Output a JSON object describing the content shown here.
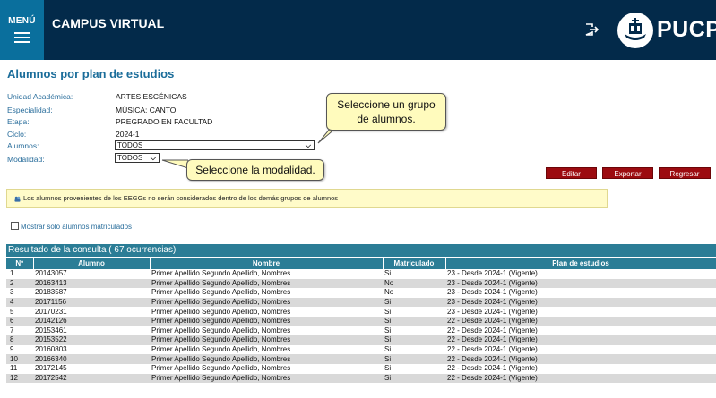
{
  "header": {
    "menu_label": "MENÚ",
    "app_title": "CAMPUS VIRTUAL",
    "logo_text": "PUCP",
    "icons": [
      "hamburger-icon",
      "logout-icon",
      "pucp-logo-icon"
    ]
  },
  "page": {
    "title": "Alumnos por plan de estudios"
  },
  "fields": {
    "unidad_label": "Unidad Académica:",
    "unidad_value": "ARTES ESCÉNICAS",
    "especialidad_label": "Especialidad:",
    "especialidad_value": "MÚSICA: CANTO",
    "etapa_label": "Etapa:",
    "etapa_value": "PREGRADO EN FACULTAD",
    "ciclo_label": "Ciclo:",
    "ciclo_value": "2024-1",
    "alumnos_label": "Alumnos:",
    "alumnos_selected": "TODOS",
    "modalidad_label": "Modalidad:",
    "modalidad_selected": "TODOS"
  },
  "callouts": {
    "grupo_line1": "Seleccione un grupo",
    "grupo_line2": "de alumnos.",
    "modalidad": "Seleccione la modalidad."
  },
  "buttons": {
    "editar": "Editar",
    "exportar": "Exportar",
    "regresar": "Regresar"
  },
  "notice": {
    "text": "Los alumnos provenientes de los EEGGs no serán considerados dentro de los demás grupos de alumnos"
  },
  "filter": {
    "only_enrolled_label": "Mostrar solo alumnos matriculados"
  },
  "results": {
    "title": "Resultado de la consulta ( 67 ocurrencias)",
    "columns": [
      "Nº",
      "Alumno",
      "Nombre",
      "Matriculado",
      "Plan de estudios"
    ],
    "rows": [
      [
        "1",
        "20143057",
        "Primer Apellido Segundo Apellido, Nombres",
        "Si",
        "23 - Desde 2024-1 (Vigente)"
      ],
      [
        "2",
        "20163413",
        "Primer Apellido Segundo Apellido, Nombres",
        "No",
        "23 - Desde 2024-1 (Vigente)"
      ],
      [
        "3",
        "20183587",
        "Primer Apellido Segundo Apellido, Nombres",
        "No",
        "23 - Desde 2024-1 (Vigente)"
      ],
      [
        "4",
        "20171156",
        "Primer Apellido Segundo Apellido, Nombres",
        "Si",
        "23 - Desde 2024-1 (Vigente)"
      ],
      [
        "5",
        "20170231",
        "Primer Apellido Segundo Apellido, Nombres",
        "Si",
        "23 - Desde 2024-1 (Vigente)"
      ],
      [
        "6",
        "20142126",
        "Primer Apellido Segundo Apellido, Nombres",
        "Si",
        "22 - Desde 2024-1 (Vigente)"
      ],
      [
        "7",
        "20153461",
        "Primer Apellido Segundo Apellido, Nombres",
        "Si",
        "22 - Desde 2024-1 (Vigente)"
      ],
      [
        "8",
        "20153522",
        "Primer Apellido Segundo Apellido, Nombres",
        "Si",
        "22 - Desde 2024-1 (Vigente)"
      ],
      [
        "9",
        "20160803",
        "Primer Apellido Segundo Apellido, Nombres",
        "Si",
        "22 - Desde 2024-1 (Vigente)"
      ],
      [
        "10",
        "20166340",
        "Primer Apellido Segundo Apellido, Nombres",
        "Si",
        "22 - Desde 2024-1 (Vigente)"
      ],
      [
        "11",
        "20172145",
        "Primer Apellido Segundo Apellido, Nombres",
        "Si",
        "22 - Desde 2024-1 (Vigente)"
      ],
      [
        "12",
        "20172542",
        "Primer Apellido Segundo Apellido, Nombres",
        "Si",
        "22 - Desde 2024-1 (Vigente)"
      ]
    ]
  },
  "colors": {
    "header_bg": "#032a4a",
    "menu_bg": "#0a6f9d",
    "title_blue": "#1b6d9a",
    "table_header": "#2b7d96",
    "button_red": "#9c0b10",
    "callout_bg": "#fffbbd"
  }
}
